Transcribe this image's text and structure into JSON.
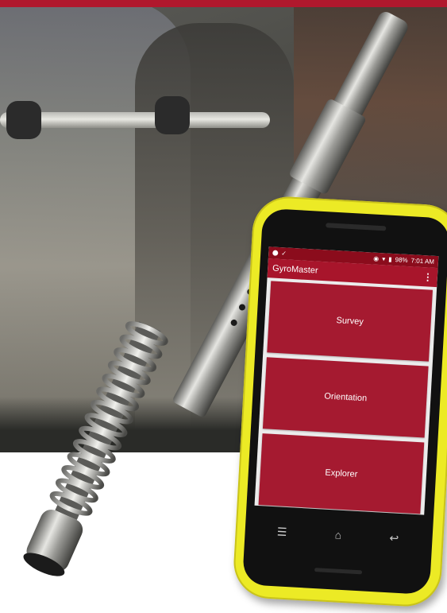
{
  "phone": {
    "statusbar": {
      "battery": "98%",
      "time": "7:01 AM"
    },
    "app_title": "GyroMaster",
    "menu_icon": "overflow-menu-icon",
    "tiles": [
      {
        "label": "Survey"
      },
      {
        "label": "Orientation"
      },
      {
        "label": "Explorer"
      }
    ],
    "nav": [
      {
        "icon": "menu-icon",
        "glyph": "☰"
      },
      {
        "icon": "home-icon",
        "glyph": "⌂"
      },
      {
        "icon": "back-icon",
        "glyph": "↩"
      }
    ]
  },
  "colors": {
    "brand_red": "#b0182d",
    "phone_yellow": "#ecea25",
    "tile_red": "#a51a30"
  }
}
